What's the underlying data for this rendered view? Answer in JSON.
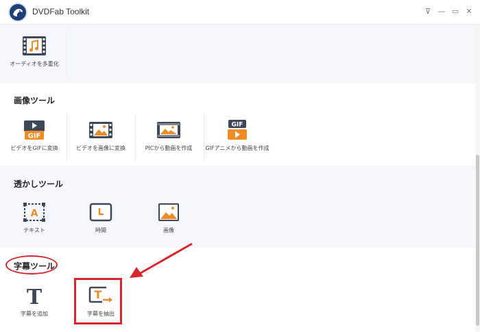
{
  "window": {
    "title": "DVDFab Toolkit"
  },
  "window_controls": {
    "pin": "⊽",
    "minimize": "—",
    "maximize": "▭",
    "close": "✕"
  },
  "sections": {
    "audio": {
      "tools": [
        {
          "label": "オーディオを多重化",
          "icon": "music-film-icon"
        }
      ]
    },
    "image": {
      "title": "画像ツール",
      "tools": [
        {
          "label": "ビデオをGIFに変換",
          "icon": "video-to-gif-icon"
        },
        {
          "label": "ビデオを画像に変換",
          "icon": "video-to-image-icon"
        },
        {
          "label": "PICから動画を作成",
          "icon": "pic-to-video-icon"
        },
        {
          "label": "GIFアニメから動画を作成",
          "icon": "gif-to-video-icon"
        }
      ]
    },
    "watermark": {
      "title": "透かしツール",
      "tools": [
        {
          "label": "テキスト",
          "icon": "text-watermark-icon"
        },
        {
          "label": "時間",
          "icon": "clock-icon"
        },
        {
          "label": "画像",
          "icon": "image-icon"
        }
      ]
    },
    "subtitle": {
      "title": "字幕ツール",
      "tools": [
        {
          "label": "字幕を追加",
          "icon": "add-subtitle-icon"
        },
        {
          "label": "字幕を抽出",
          "icon": "extract-subtitle-icon"
        }
      ]
    }
  },
  "icon_text": {
    "gif_badge": "GIF",
    "gif_badge2": "GIF",
    "text_letter": "A",
    "sub_letter": "T",
    "sub_letter2": "T"
  },
  "colors": {
    "accent_orange": "#f08a24",
    "dark_slate": "#3d4757",
    "annotation_red": "#d9262c",
    "section_bg": "#f5f7fc"
  }
}
